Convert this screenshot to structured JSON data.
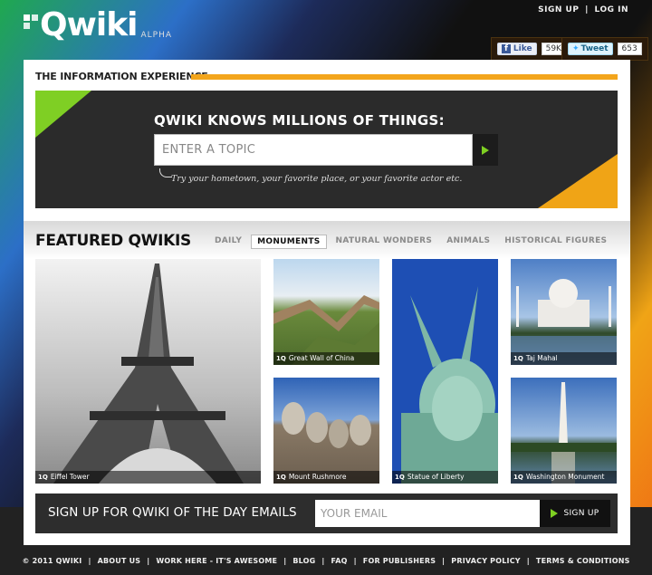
{
  "header": {
    "logo_text": "Qwiki",
    "alpha": "ALPHA",
    "sign_up": "SIGN UP",
    "separator": "|",
    "log_in": "LOG IN",
    "like_label": "Like",
    "like_count": "59K",
    "tweet_label": "Tweet",
    "tweet_count": "653"
  },
  "hero": {
    "section_label": "THE INFORMATION EXPERIENCE",
    "title": "QWIKI KNOWS MILLIONS OF THINGS:",
    "search_placeholder": "ENTER A TOPIC",
    "hint": "Try your hometown, your favorite place, or your favorite actor etc."
  },
  "featured": {
    "title": "FEATURED QWIKIS",
    "tabs": [
      "DAILY",
      "MONUMENTS",
      "NATURAL WONDERS",
      "ANIMALS",
      "HISTORICAL FIGURES"
    ],
    "active_tab": "MONUMENTS",
    "badge": "1Q",
    "tiles": [
      "Eiffel Tower",
      "Great Wall of China",
      "Taj Mahal",
      "Mount Rushmore",
      "Statue of Liberty",
      "Washington Monument"
    ]
  },
  "signup": {
    "text": "SIGN UP FOR QWIKI OF THE DAY EMAILS",
    "email_placeholder": "YOUR EMAIL",
    "button": "SIGN UP"
  },
  "footer": {
    "links": [
      "© 2011 QWIKI",
      "ABOUT US",
      "WORK HERE - IT'S AWESOME",
      "BLOG",
      "FAQ",
      "FOR PUBLISHERS",
      "PRIVACY POLICY",
      "TERMS & CONDITIONS"
    ],
    "separator": "|"
  },
  "colors": {
    "accent_orange": "#f3a51c",
    "accent_green": "#7ecf22",
    "panel_dark": "#2b2b2b"
  }
}
